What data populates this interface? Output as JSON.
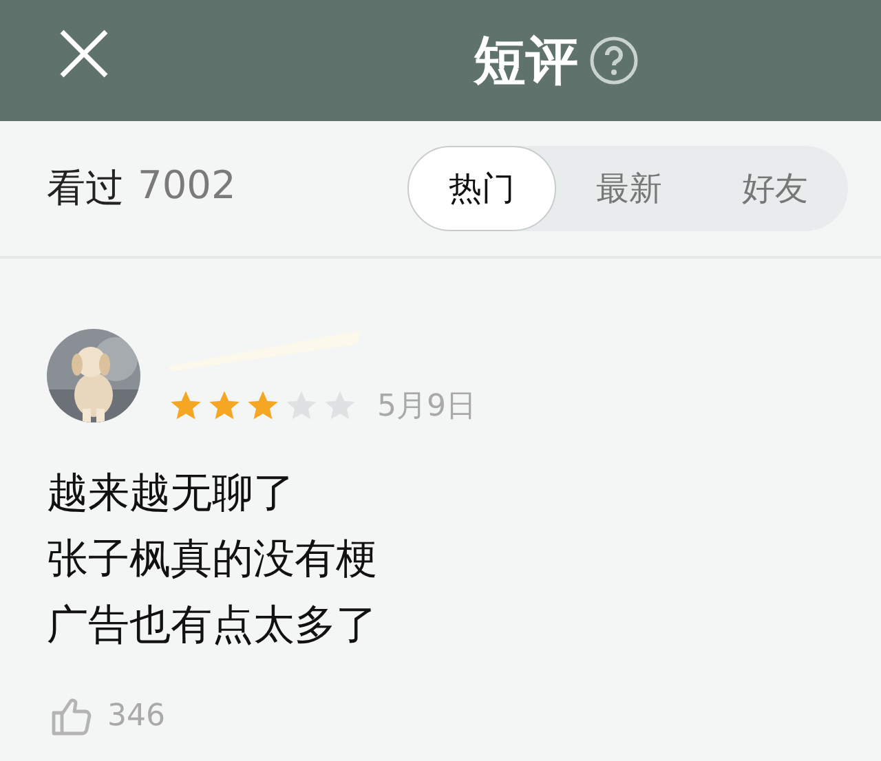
{
  "header": {
    "title": "短评"
  },
  "summary": {
    "label": "看过",
    "count": "7002"
  },
  "tabs": [
    {
      "label": "热门",
      "selected": true
    },
    {
      "label": "最新",
      "selected": false
    },
    {
      "label": "好友",
      "selected": false
    }
  ],
  "review": {
    "stars": 3,
    "date": "5月9日",
    "lines": [
      "越来越无聊了",
      "张子枫真的没有梗",
      "广告也有点太多了"
    ],
    "likes": "346"
  }
}
